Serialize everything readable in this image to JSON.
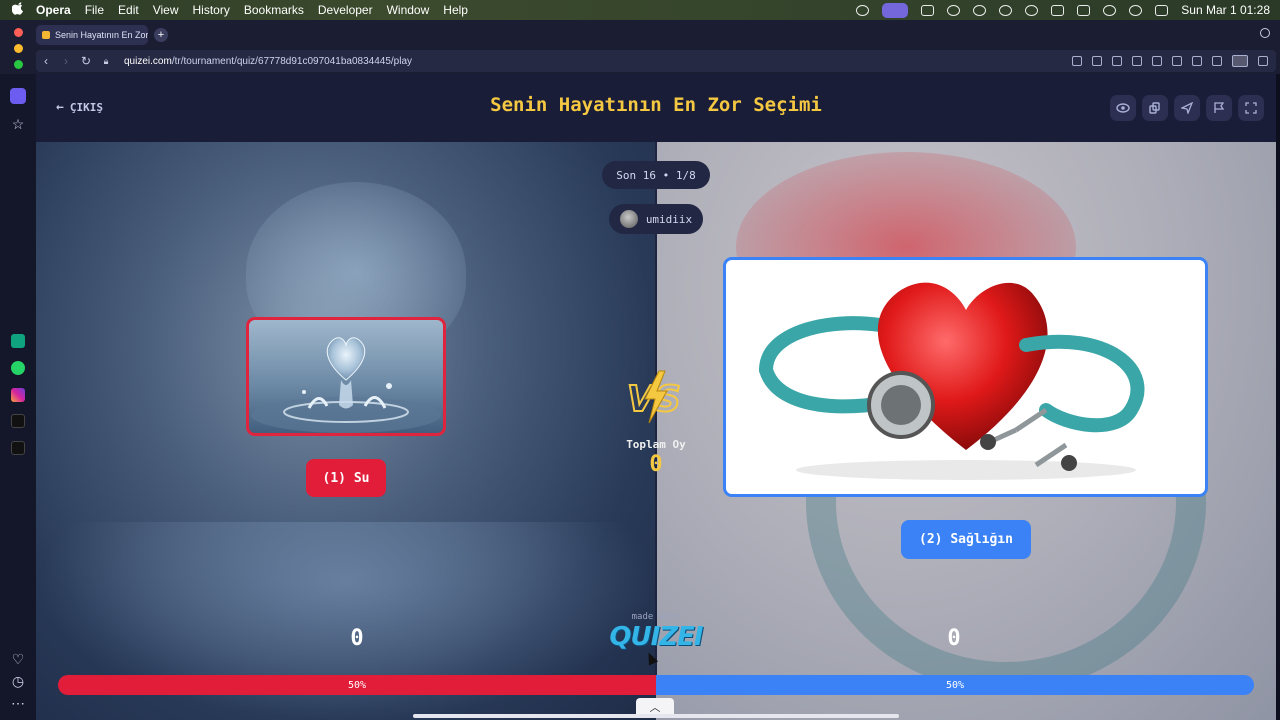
{
  "menubar": {
    "app": "Opera",
    "items": [
      "File",
      "Edit",
      "View",
      "History",
      "Bookmarks",
      "Developer",
      "Window",
      "Help"
    ],
    "clock": "Sun Mar 1  01:28"
  },
  "browser": {
    "tab_title": "Senin Hayatının En Zor S",
    "url_domain": "quizei.com",
    "url_path": "/tr/tournament/quiz/67778d91c097041ba0834445/play"
  },
  "quiz": {
    "exit_label": "ÇIKIŞ",
    "title": "Senin Hayatının En Zor Seçimi",
    "round": "Son 16 • 1/8",
    "username": "umidiix",
    "vs_label": "VS",
    "total_votes_label": "Toplam Oy",
    "total_votes": "0",
    "left": {
      "label": "(1) Su",
      "score": "0",
      "percent": "50%"
    },
    "right": {
      "label": "(2) Sağlığın",
      "score": "0",
      "percent": "50%"
    },
    "made_with": "made with",
    "brand": "QUIZEI"
  },
  "colors": {
    "title": "#f5c842",
    "left_accent": "#e11d3a",
    "right_accent": "#3b82f6"
  },
  "icons": {
    "toolbar": [
      "eye-icon",
      "copy-icon",
      "share-icon",
      "flag-icon",
      "fullscreen-icon"
    ]
  }
}
